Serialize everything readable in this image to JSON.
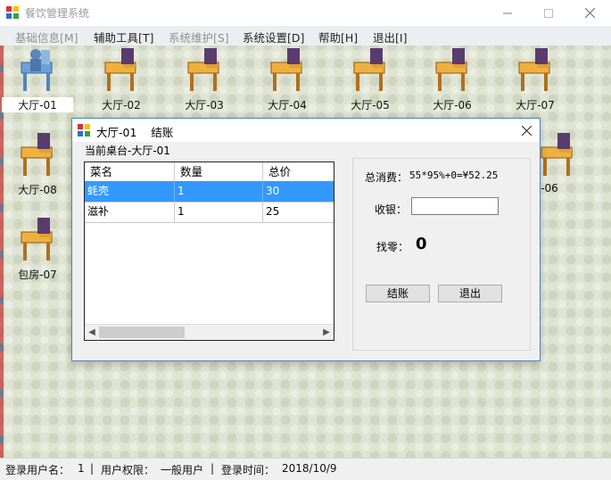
{
  "app": {
    "title": "餐饮管理系统"
  },
  "menu": [
    {
      "label": "基础信息[M]",
      "disabled": true
    },
    {
      "label": "辅助工具[T]",
      "disabled": false
    },
    {
      "label": "系统维护[S]",
      "disabled": true
    },
    {
      "label": "系统设置[D]",
      "disabled": false
    },
    {
      "label": "帮助[H]",
      "disabled": false
    },
    {
      "label": "退出[I]",
      "disabled": false
    }
  ],
  "desks": [
    {
      "label": "大厅-01",
      "state": "occupied"
    },
    {
      "label": "大厅-02",
      "state": "free"
    },
    {
      "label": "大厅-03",
      "state": "free"
    },
    {
      "label": "大厅-04",
      "state": "free"
    },
    {
      "label": "大厅-05",
      "state": "free"
    },
    {
      "label": "大厅-06",
      "state": "free"
    },
    {
      "label": "大厅-07",
      "state": "free"
    },
    {
      "label": "大厅-08",
      "state": "free"
    },
    {
      "label": "-06",
      "state": "free"
    },
    {
      "label": "包房-07",
      "state": "free"
    }
  ],
  "status": {
    "user_label": "登录用户名：",
    "user_value": "1",
    "sep1": "|",
    "role_label": "用户权限：",
    "role_value": "一般用户",
    "sep2": "|",
    "time_label": "登录时间：",
    "time_value": "2018/10/9"
  },
  "dialog": {
    "title": "大厅-01    结账",
    "caption": "当前桌台-大厅-01",
    "columns": [
      "菜名",
      "数量",
      "总价"
    ],
    "rows": [
      {
        "name": "蚝壳",
        "qty": "1",
        "total": "30",
        "selected": true
      },
      {
        "name": "滋补",
        "qty": "1",
        "total": "25",
        "selected": false
      }
    ],
    "total_label": "总消费：",
    "total_value": "55*95%+0=¥52.25",
    "paid_label": "收银：",
    "paid_value": "",
    "change_label": "找零：",
    "change_value": "0",
    "checkout_button": "结账",
    "exit_button": "退出"
  }
}
